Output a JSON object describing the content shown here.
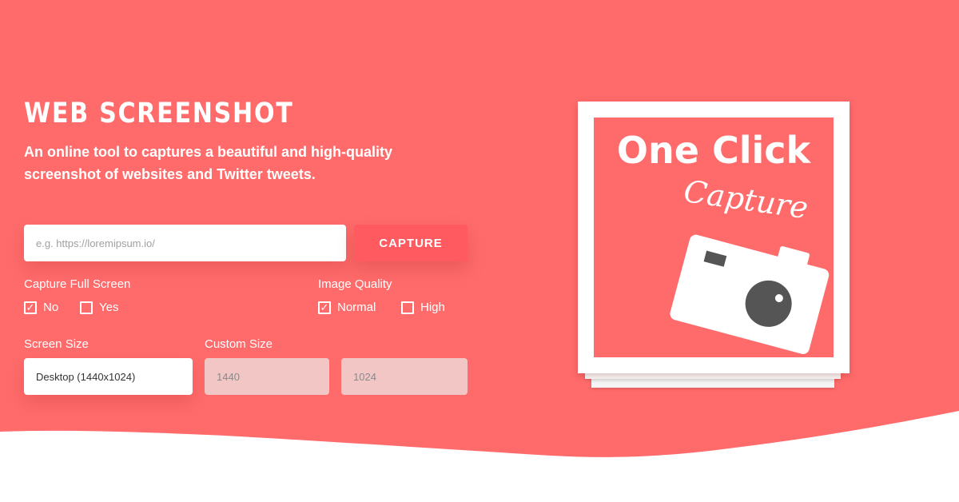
{
  "colors": {
    "brand": "#ff6b6b",
    "button": "#ff5a5f",
    "disabled_field": "#f3c6c6",
    "camera_lens": "#555555"
  },
  "header": {
    "title": "WEB SCREENSHOT",
    "subtitle": "An online tool to captures a beautiful and high-quality screenshot of websites and Twitter tweets."
  },
  "form": {
    "url_placeholder": "e.g. https://loremipsum.io/",
    "url_value": "",
    "capture_label": "CAPTURE",
    "full_screen": {
      "label": "Capture Full Screen",
      "options": [
        {
          "label": "No",
          "checked": true
        },
        {
          "label": "Yes",
          "checked": false
        }
      ]
    },
    "image_quality": {
      "label": "Image Quality",
      "options": [
        {
          "label": "Normal",
          "checked": true
        },
        {
          "label": "High",
          "checked": false
        }
      ]
    },
    "screen_size": {
      "label": "Screen Size",
      "value": "Desktop (1440x1024)"
    },
    "custom_size": {
      "label": "Custom Size",
      "width_placeholder": "1440",
      "height_placeholder": "1024"
    }
  },
  "illustration": {
    "logo_main": "One Click",
    "logo_script": "Capture",
    "icon": "camera-icon"
  }
}
